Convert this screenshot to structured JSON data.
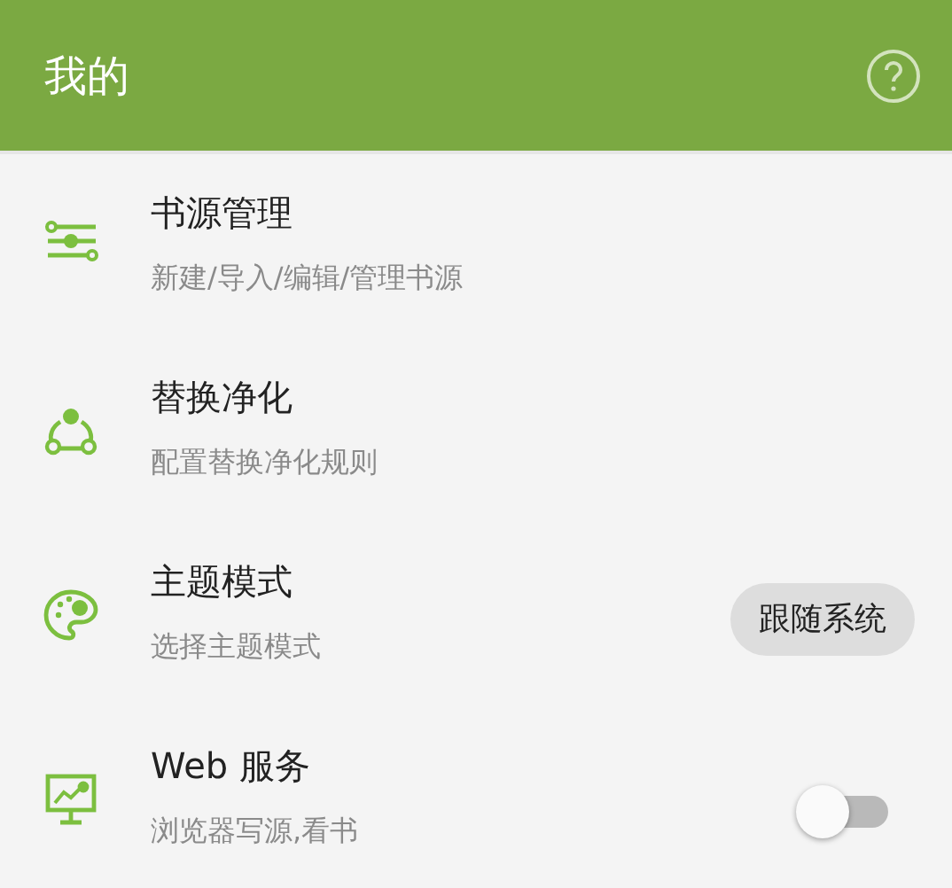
{
  "app_bar": {
    "title": "我的"
  },
  "items": [
    {
      "kind": "plain",
      "title": "书源管理",
      "subtitle": "新建/导入/编辑/管理书源"
    },
    {
      "kind": "plain",
      "title": "替换净化",
      "subtitle": "配置替换净化规则"
    },
    {
      "kind": "button",
      "title": "主题模式",
      "subtitle": "选择主题模式",
      "button": "跟随系统"
    },
    {
      "kind": "switch",
      "title": "Web 服务",
      "subtitle": "浏览器写源,看书",
      "on": false
    }
  ]
}
